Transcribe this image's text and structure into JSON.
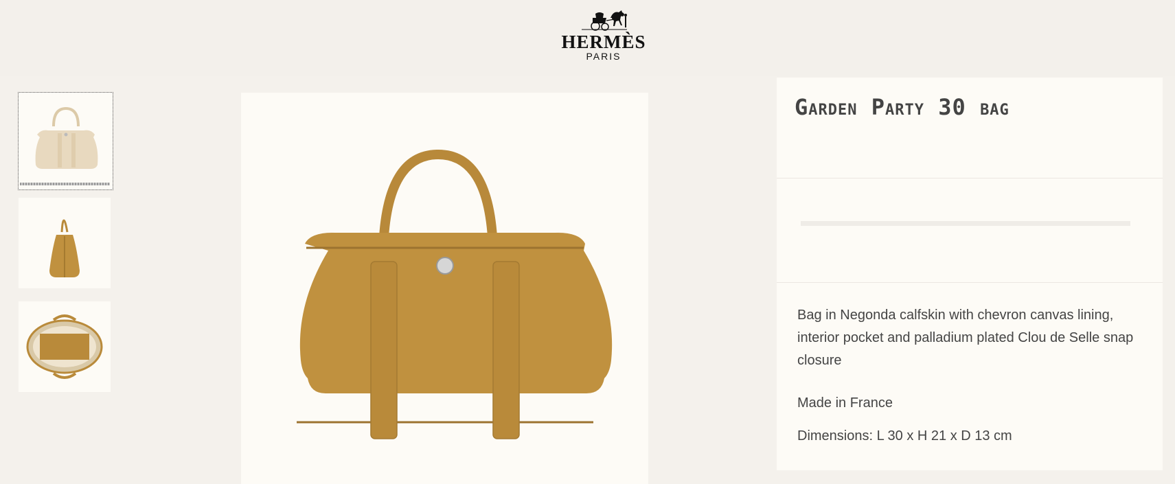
{
  "header": {
    "brand": "HERMÈS",
    "city": "PARIS",
    "logo_icon": "horse-carriage-icon"
  },
  "gallery": {
    "thumbnails": [
      {
        "view": "front",
        "color": "#e8d9bf",
        "active": true
      },
      {
        "view": "side",
        "color": "#b98a3a",
        "active": false
      },
      {
        "view": "top",
        "color": "#b98a3a",
        "active": false
      }
    ],
    "main_color": "#c0913f"
  },
  "product": {
    "title": "Garden Party 30 bag",
    "description": "Bag in Negonda calfskin with chevron canvas lining, interior pocket and palladium plated Clou de Selle snap closure",
    "origin": "Made in France",
    "dimensions": "Dimensions: L 30 x H 21 x D 13 cm"
  }
}
